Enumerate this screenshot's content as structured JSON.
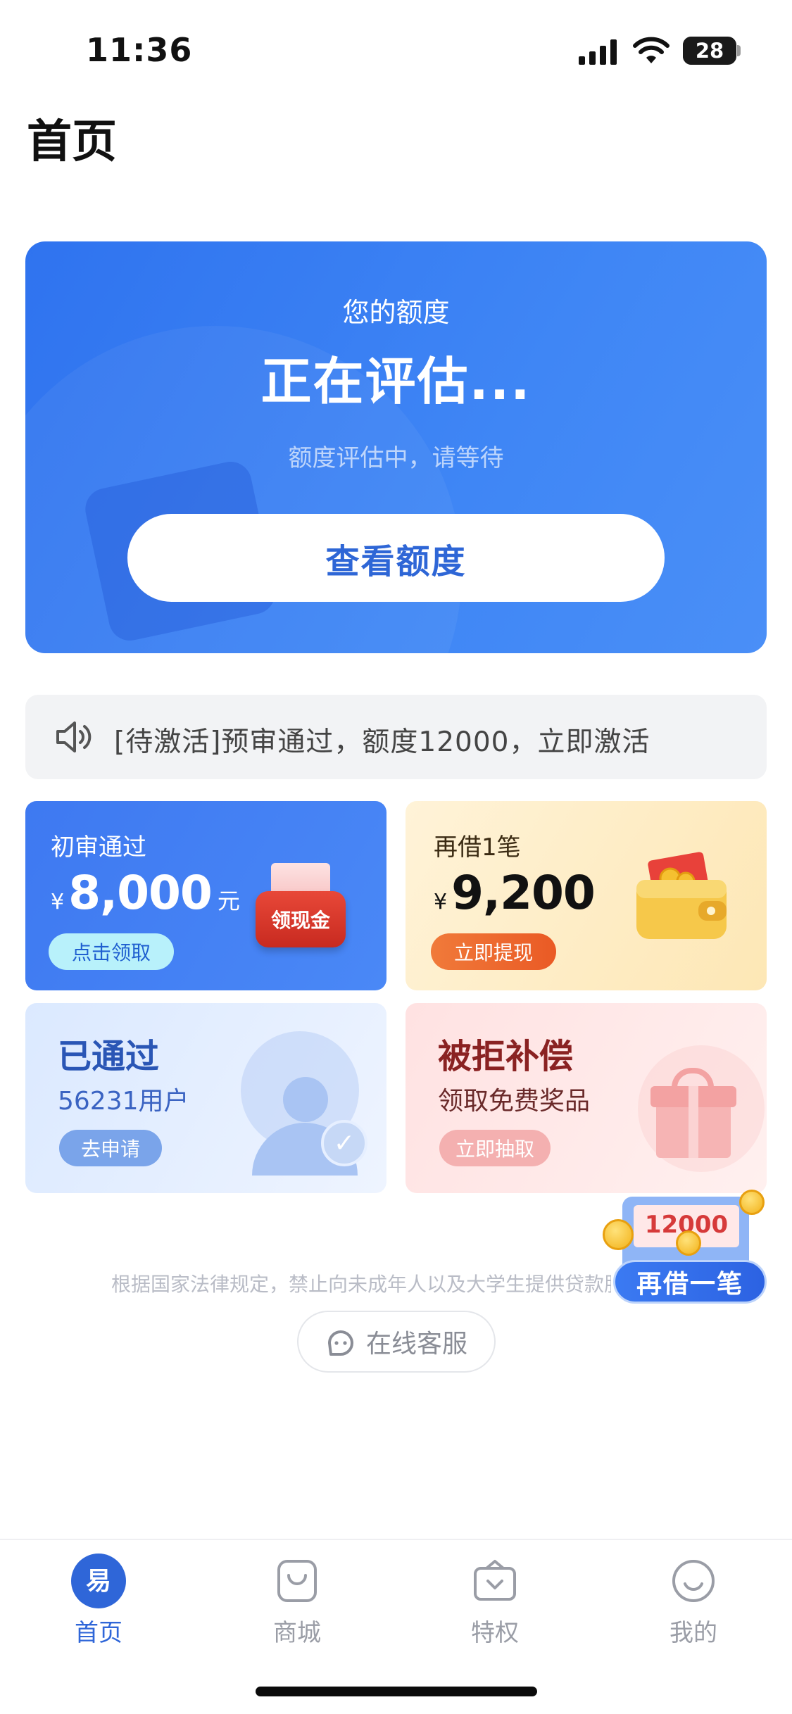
{
  "status_bar": {
    "time": "11:36",
    "battery_level": "28",
    "battery_fraction": 0.28
  },
  "header": {
    "title": "首页"
  },
  "hero": {
    "subtitle": "您的额度",
    "status": "正在评估...",
    "hint": "额度评估中，请等待",
    "button": "查看额度",
    "accent": "#3a80f3"
  },
  "notice": {
    "icon": "speaker-icon",
    "text": "[待激活]预审通过，额度12000，立即激活"
  },
  "tiles": [
    {
      "label": "初审通过",
      "currency": "¥",
      "amount": "8,000",
      "unit": "元",
      "button": "点击领取",
      "badge": "领现金"
    },
    {
      "label": "再借1笔",
      "currency": "¥",
      "amount": "9,200",
      "button": "立即提现"
    },
    {
      "title": "已通过",
      "subtitle": "56231用户",
      "button": "去申请"
    },
    {
      "title": "被拒补偿",
      "subtitle": "领取免费奖品",
      "button": "立即抽取"
    }
  ],
  "floating": {
    "amount": "12000",
    "button": "再借一笔"
  },
  "disclaimer": "根据国家法律规定，禁止向未成年人以及大学生提供贷款服务",
  "service": {
    "label": "在线客服",
    "icon": "customer-service-icon"
  },
  "tabs": [
    {
      "label": "首页",
      "icon": "home-icon",
      "active": true
    },
    {
      "label": "商城",
      "icon": "shop-bag-icon"
    },
    {
      "label": "特权",
      "icon": "privilege-icon"
    },
    {
      "label": "我的",
      "icon": "profile-smile-icon"
    }
  ],
  "colors": {
    "primary": "#2f66d8",
    "orange": "#ea5a25",
    "text": "#222222"
  }
}
